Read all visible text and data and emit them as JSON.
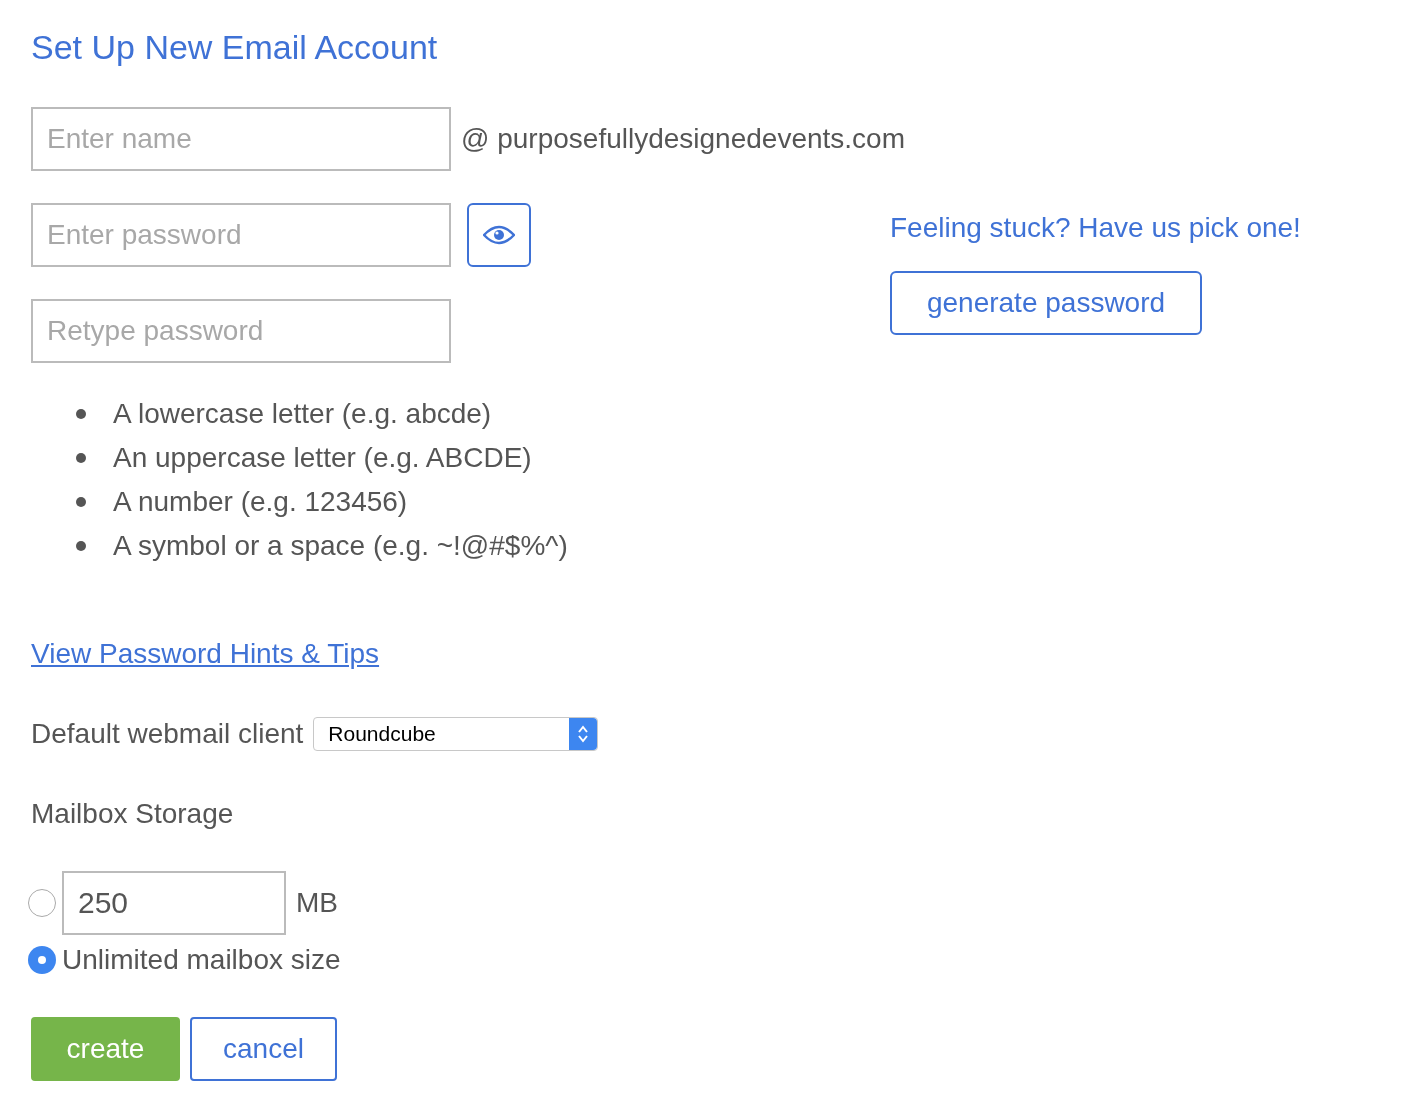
{
  "title": "Set Up New Email Account",
  "name_field": {
    "placeholder": "Enter name"
  },
  "domain": "@ purposefullydesignedevents.com",
  "password_field": {
    "placeholder": "Enter password"
  },
  "retype_field": {
    "placeholder": "Retype password"
  },
  "suggestion": "Feeling stuck? Have us pick one!",
  "generate_button": "generate password",
  "requirements": [
    "A lowercase letter (e.g. abcde)",
    "An uppercase letter (e.g. ABCDE)",
    "A number (e.g. 123456)",
    "A symbol or a space (e.g. ~!@#$%^)"
  ],
  "hints_link": "View Password Hints & Tips",
  "webmail": {
    "label": "Default webmail client",
    "value": "Roundcube"
  },
  "storage": {
    "label": "Mailbox Storage",
    "options": [
      {
        "kind": "quota",
        "value": "250",
        "unit": "MB",
        "selected": false
      },
      {
        "kind": "unlimited",
        "label": "Unlimited mailbox size",
        "selected": true
      }
    ]
  },
  "buttons": [
    {
      "kind": "primary",
      "label": "create"
    },
    {
      "kind": "secondary",
      "label": "cancel"
    }
  ]
}
